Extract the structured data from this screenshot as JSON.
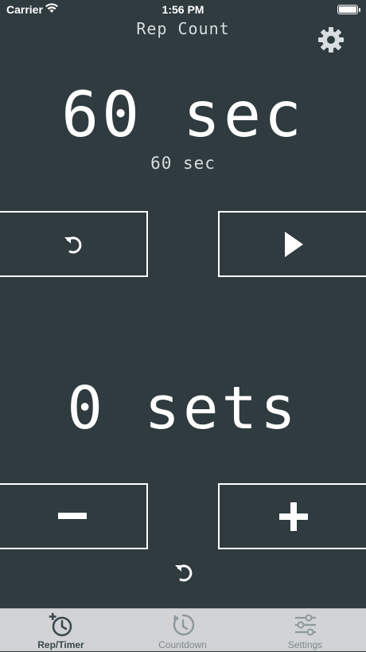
{
  "status_bar": {
    "carrier": "Carrier",
    "time": "1:56 PM"
  },
  "header": {
    "title": "Rep Count",
    "settings_icon": "gear-icon"
  },
  "timer": {
    "value": "60 sec",
    "sub_value": "60 sec"
  },
  "sets": {
    "value": "0 sets"
  },
  "controls": {
    "reset_timer_icon": "reset-icon",
    "play_icon": "play-icon",
    "decrement_icon": "minus-icon",
    "increment_icon": "plus-icon",
    "reset_sets_icon": "reset-icon"
  },
  "tabbar": {
    "tabs": [
      {
        "label": "Rep/Timer",
        "icon": "rep-timer-icon",
        "active": true
      },
      {
        "label": "Countdown",
        "icon": "countdown-icon",
        "active": false
      },
      {
        "label": "Settings",
        "icon": "sliders-icon",
        "active": false
      }
    ]
  },
  "colors": {
    "background": "#2f3b3f",
    "foreground": "#ffffff",
    "tabbar": "#d1d3d4",
    "active_tab": "#3a474c",
    "inactive_tab": "#7f8a8e"
  }
}
